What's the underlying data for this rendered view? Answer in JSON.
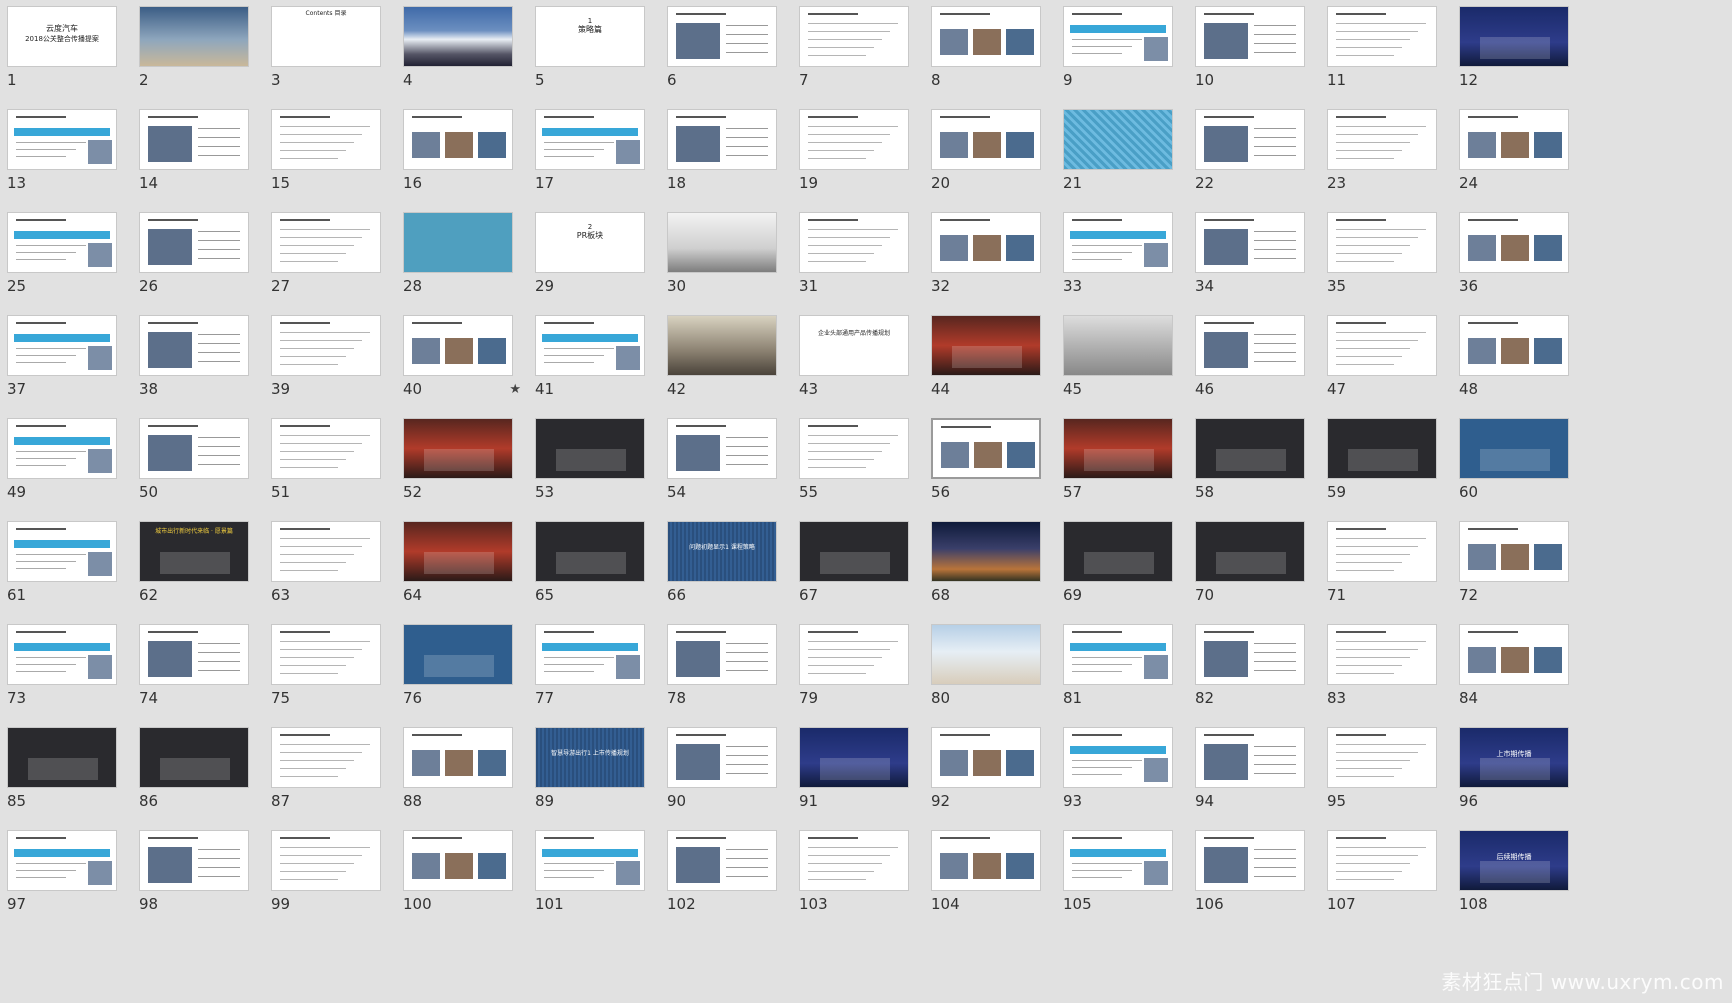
{
  "slide_numbers": [
    "1",
    "2",
    "3",
    "4",
    "5",
    "6",
    "7",
    "8",
    "9",
    "10",
    "11",
    "12",
    "13",
    "14",
    "15",
    "16",
    "17",
    "18",
    "19",
    "20",
    "21",
    "22",
    "23",
    "24",
    "25",
    "26",
    "27",
    "28",
    "29",
    "30",
    "31",
    "32",
    "33",
    "34",
    "35",
    "36",
    "37",
    "38",
    "39",
    "40",
    "41",
    "42",
    "43",
    "44",
    "45",
    "46",
    "47",
    "48",
    "49",
    "50",
    "51",
    "52",
    "53",
    "54",
    "55",
    "56",
    "57",
    "58",
    "59",
    "60",
    "61",
    "62",
    "63",
    "64",
    "65",
    "66",
    "67",
    "68",
    "69",
    "70",
    "71",
    "72",
    "73",
    "74",
    "75",
    "76",
    "77",
    "78",
    "79",
    "80",
    "81",
    "82",
    "83",
    "84",
    "85",
    "86",
    "87",
    "88",
    "89",
    "90",
    "91",
    "92",
    "93",
    "94",
    "95",
    "96",
    "97",
    "98",
    "99",
    "100",
    "101",
    "102",
    "103",
    "104",
    "105",
    "106",
    "107",
    "108"
  ],
  "selected_slide": "56",
  "starred_slide": "40",
  "star_glyph": "★",
  "slide_text": {
    "s1_line1": "云度汽车",
    "s1_line2": "2018公关整合传播提案",
    "s3": "Contents 目录",
    "s5_num": "1",
    "s5": "策略篇",
    "s29_num": "2",
    "s29": "PR板块",
    "s43": "企业头部通用产品传播规划",
    "s62": "城市出行新时代来临 · 愿景篇",
    "s66": "问题初题显示1 课程策略",
    "s89": "智慧导游出行1 上市传播规划",
    "s96": "上市期传播",
    "s108": "后续期传播"
  },
  "watermark": "素材狂点门 www.uxrym.com"
}
